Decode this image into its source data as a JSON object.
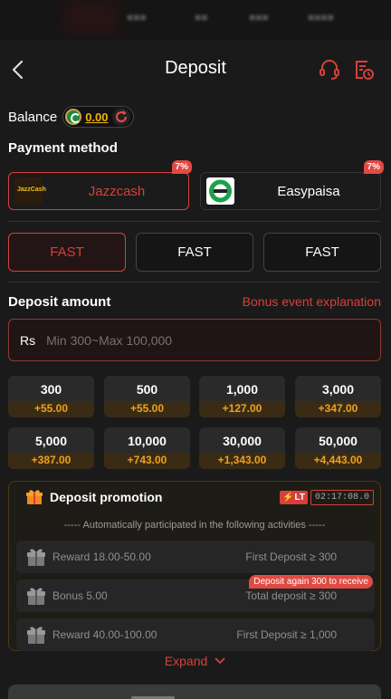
{
  "header": {
    "title": "Deposit"
  },
  "balance": {
    "label": "Balance",
    "value": "0.00"
  },
  "payment": {
    "title": "Payment method",
    "methods": [
      {
        "name": "Jazzcash",
        "logo_text": "JazzCash",
        "badge": "7%",
        "selected": true
      },
      {
        "name": "Easypaisa",
        "badge": "7%",
        "selected": false
      }
    ]
  },
  "channels": [
    "FAST",
    "FAST",
    "FAST"
  ],
  "deposit": {
    "title": "Deposit amount",
    "bonus_link": "Bonus event explanation",
    "currency": "Rs",
    "placeholder": "Min 300~Max 100,000"
  },
  "amounts": [
    {
      "amount": "300",
      "bonus": "+55.00"
    },
    {
      "amount": "500",
      "bonus": "+55.00"
    },
    {
      "amount": "1,000",
      "bonus": "+127.00"
    },
    {
      "amount": "3,000",
      "bonus": "+347.00"
    },
    {
      "amount": "5,000",
      "bonus": "+387.00"
    },
    {
      "amount": "10,000",
      "bonus": "+743.00"
    },
    {
      "amount": "30,000",
      "bonus": "+1,343.00"
    },
    {
      "amount": "50,000",
      "bonus": "+4,443.00"
    }
  ],
  "promotion": {
    "title": "Deposit promotion",
    "timer_label": "LT",
    "timer": "02:17:08.0",
    "note": "----- Automatically participated in the following activities -----",
    "rewards": [
      {
        "name": "Reward 18.00-50.00",
        "condition": "First Deposit ≥ 300"
      },
      {
        "name": "Bonus 5.00",
        "condition": "Total deposit ≥ 300",
        "tag": "Deposit again 300 to receive"
      },
      {
        "name": "Reward 40.00-100.00",
        "condition": "First Deposit ≥ 1,000"
      }
    ],
    "expand_label": "Expand"
  },
  "colors": {
    "accent": "#d6403a",
    "bonus": "#f0a020",
    "background": "#1a1a1a"
  }
}
